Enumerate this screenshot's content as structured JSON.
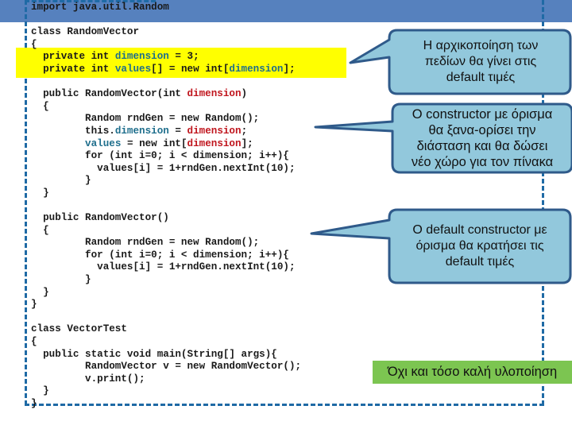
{
  "slide": {
    "header_code": "import java.util.Random",
    "code_lines": [
      {
        "id": "l2",
        "segments": [
          {
            "t": "class RandomVector",
            "c": ""
          }
        ]
      },
      {
        "id": "l3",
        "segments": [
          {
            "t": "{",
            "c": ""
          }
        ]
      },
      {
        "id": "l4",
        "segments": [
          {
            "t": "  private int ",
            "c": ""
          },
          {
            "t": "dimension",
            "c": "kw-field"
          },
          {
            "t": " = 3;",
            "c": ""
          }
        ]
      },
      {
        "id": "l5",
        "segments": [
          {
            "t": "  private int ",
            "c": ""
          },
          {
            "t": "values",
            "c": "kw-field"
          },
          {
            "t": "[] = new int[",
            "c": ""
          },
          {
            "t": "dimension",
            "c": "kw-field"
          },
          {
            "t": "];",
            "c": ""
          }
        ]
      },
      {
        "id": "l6",
        "segments": [
          {
            "t": "",
            "c": ""
          }
        ]
      },
      {
        "id": "l7",
        "segments": [
          {
            "t": "  public RandomVector(int ",
            "c": ""
          },
          {
            "t": "dimension",
            "c": "kw-param"
          },
          {
            "t": ")",
            "c": ""
          }
        ]
      },
      {
        "id": "l8",
        "segments": [
          {
            "t": "  {",
            "c": ""
          }
        ]
      },
      {
        "id": "l9",
        "segments": [
          {
            "t": "         Random rndGen = new Random();",
            "c": ""
          }
        ]
      },
      {
        "id": "l10",
        "segments": [
          {
            "t": "         this.",
            "c": ""
          },
          {
            "t": "dimension",
            "c": "kw-field"
          },
          {
            "t": " = ",
            "c": ""
          },
          {
            "t": "dimension",
            "c": "kw-param"
          },
          {
            "t": ";",
            "c": ""
          }
        ]
      },
      {
        "id": "l11",
        "segments": [
          {
            "t": "         ",
            "c": ""
          },
          {
            "t": "values",
            "c": "kw-field"
          },
          {
            "t": " = new int[",
            "c": ""
          },
          {
            "t": "dimension",
            "c": "kw-param"
          },
          {
            "t": "];",
            "c": ""
          }
        ]
      },
      {
        "id": "l12",
        "segments": [
          {
            "t": "         for (int i=0; i < dimension; i++){",
            "c": ""
          }
        ]
      },
      {
        "id": "l13",
        "segments": [
          {
            "t": "           values[i] = 1+rndGen.nextInt(10);",
            "c": ""
          }
        ]
      },
      {
        "id": "l14",
        "segments": [
          {
            "t": "         }",
            "c": ""
          }
        ]
      },
      {
        "id": "l15",
        "segments": [
          {
            "t": "  }",
            "c": ""
          }
        ]
      },
      {
        "id": "l16",
        "segments": [
          {
            "t": "",
            "c": ""
          }
        ]
      },
      {
        "id": "l17",
        "segments": [
          {
            "t": "  public RandomVector()",
            "c": ""
          }
        ]
      },
      {
        "id": "l18",
        "segments": [
          {
            "t": "  {",
            "c": ""
          }
        ]
      },
      {
        "id": "l19",
        "segments": [
          {
            "t": "         Random rndGen = new Random();",
            "c": ""
          }
        ]
      },
      {
        "id": "l20",
        "segments": [
          {
            "t": "         for (int i=0; i < dimension; i++){",
            "c": ""
          }
        ]
      },
      {
        "id": "l21",
        "segments": [
          {
            "t": "           values[i] = 1+rndGen.nextInt(10);",
            "c": ""
          }
        ]
      },
      {
        "id": "l22",
        "segments": [
          {
            "t": "         }",
            "c": ""
          }
        ]
      },
      {
        "id": "l23",
        "segments": [
          {
            "t": "  }",
            "c": ""
          }
        ]
      },
      {
        "id": "l24",
        "segments": [
          {
            "t": "}",
            "c": ""
          }
        ]
      },
      {
        "id": "l25",
        "segments": [
          {
            "t": "",
            "c": ""
          }
        ]
      },
      {
        "id": "l26",
        "segments": [
          {
            "t": "class VectorTest",
            "c": ""
          }
        ]
      },
      {
        "id": "l27",
        "segments": [
          {
            "t": "{",
            "c": ""
          }
        ]
      },
      {
        "id": "l28",
        "segments": [
          {
            "t": "  public static void main(String[] args){",
            "c": ""
          }
        ]
      },
      {
        "id": "l29",
        "segments": [
          {
            "t": "         RandomVector v = new RandomVector();",
            "c": ""
          }
        ]
      },
      {
        "id": "l30",
        "segments": [
          {
            "t": "         v.print();",
            "c": ""
          }
        ]
      },
      {
        "id": "l31",
        "segments": [
          {
            "t": "  }",
            "c": ""
          }
        ]
      },
      {
        "id": "l32",
        "segments": [
          {
            "t": "}",
            "c": ""
          }
        ]
      }
    ],
    "callouts": [
      {
        "id": "field-init",
        "lines": [
          "Η αρχικοποίηση των",
          "πεδίων θα γίνει στις",
          "default τιμές"
        ]
      },
      {
        "id": "param-constructor",
        "lines": [
          "Ο constructor με όρισμα",
          "θα ξανα-ορίσει την",
          "διάσταση και θα δώσει",
          "νέο χώρο για τον πίνακα"
        ]
      },
      {
        "id": "default-constructor",
        "lines": [
          "Ο default constructor με",
          "όρισμα θα κρατήσει τις",
          "default τιμές"
        ]
      }
    ],
    "note": "Όχι και τόσο καλή υλοποίηση",
    "colors": {
      "header_bar": "#5681be",
      "dashed_border": "#1f6aa5",
      "highlight": "#ffff00",
      "callout_fill": "#92c8dc",
      "callout_border": "#2f5a8a",
      "note_fill": "#7cc551",
      "field_color": "#1e6e8c",
      "param_color": "#c0161e"
    }
  }
}
